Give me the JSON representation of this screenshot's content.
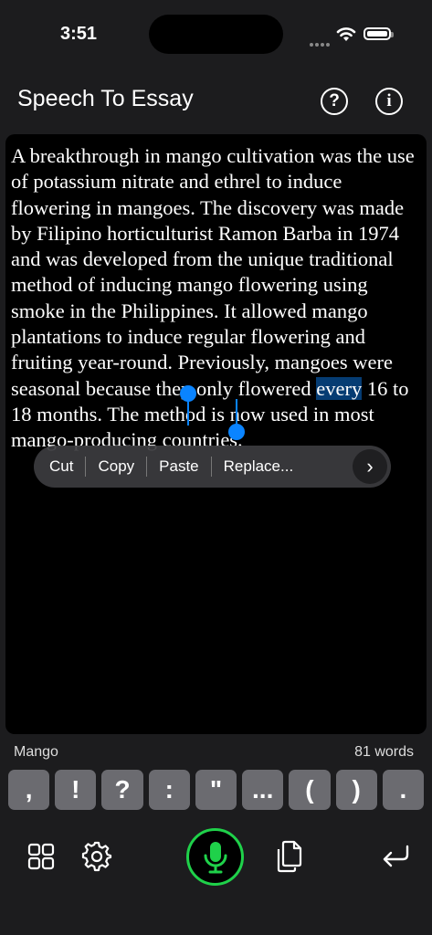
{
  "status": {
    "time": "3:51"
  },
  "nav": {
    "title": "Speech To Essay",
    "help_icon": "?",
    "info_icon": "i"
  },
  "editor": {
    "before_selection": "A breakthrough in mango cultivation was the use of potassium nitrate and ethrel to induce flowering in mangoes. The discovery was made by Filipino horticulturist Ramon Barba in 1974 and was developed from the unique traditional method of inducing mango flowering using smoke in the Philippines. It allowed mango plantations to induce regular flowering and fruiting year-round. Previously, mangoes were seasonal because they only flowered ",
    "selected": "every",
    "after_selection": " 16 to 18 months. The method is now used in most mango-producing countries."
  },
  "context_menu": {
    "cut": "Cut",
    "copy": "Copy",
    "paste": "Paste",
    "replace": "Replace...",
    "more": "›"
  },
  "footer": {
    "doc_name": "Mango",
    "word_count": "81 words"
  },
  "punctuation": [
    ",",
    "!",
    "?",
    ":",
    "\"",
    "...",
    "(",
    ")",
    "."
  ],
  "colors": {
    "mic_accent": "#1fd14a",
    "selection": "#0a84ff"
  }
}
